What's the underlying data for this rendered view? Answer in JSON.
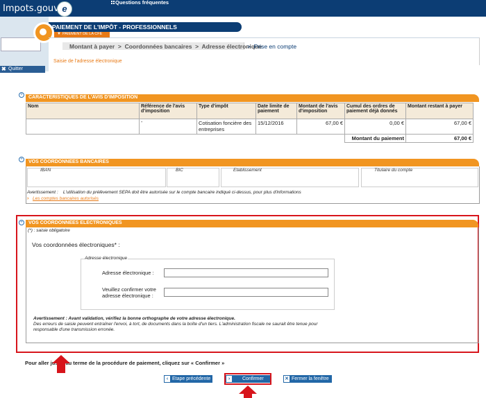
{
  "header": {
    "logo": "Impots.gouv.fr",
    "logo_mark": "e",
    "faq": "Questions fréquentes",
    "quit": "Quitter"
  },
  "titlebar": {
    "title": "PAIEMENT DE L'IMPÔT - PROFESSIONNELS",
    "subtitle_tab": "PAIEMENT DE LA CFE"
  },
  "breadcrumb": {
    "steps": "Montant à payer  >  Coordonnées bancaires  >  Adresse électronique",
    "current": ">  Prise en compte"
  },
  "page_subtitle": "Saisie de l'adresse électronique",
  "avis": {
    "title": "CARACTERISTIQUES DE L'AVIS D'IMPOSITION",
    "headers": [
      "Nom",
      "Référence de l'avis d'imposition",
      "Type d'impôt",
      "Date limite de paiement",
      "Montant de l'avis d'imposition",
      "Cumul des ordres de paiement déjà donnés",
      "Montant restant à payer"
    ],
    "row": [
      "",
      "-",
      "Cotisation foncière des entreprises",
      "15/12/2016",
      "67,00 €",
      "0,00 €",
      "67,00 €"
    ],
    "total_label": "Montant du paiement",
    "total_value": "67,00 €"
  },
  "bank": {
    "title": "VOS COORDONNEES BANCAIRES",
    "iban": "IBAN",
    "bic": "BIC",
    "etablissement": "Etablissement",
    "titulaire": "Titulaire du compte",
    "warning": "Avertissement :    L'utilisation du prélèvement SEPA doit être autorisée sur le compte bancaire indiqué ci-dessus, pour plus d'informations",
    "link": "Les comptes bancaires autorisés"
  },
  "electronic": {
    "title": "VOS COORDONNEES ELECTRONIQUES",
    "mandatory": "(*) : saisie obligatoire",
    "label": "Vos coordonnées électroniques* :",
    "fieldset_legend": "Adresse électronique",
    "email_label": "Adresse électronique :",
    "confirm_label_1": "Veuillez confirmer votre",
    "confirm_label_2": "adresse électronique :",
    "email_value": "",
    "confirm_value": "",
    "warn_1": "Avertissement : Avant validation, vérifiez la bonne orthographe de votre adresse électronique.",
    "warn_2": "Des erreurs de saisie peuvent entraîner l'envoi, à tort, de documents dans la boîte d'un tiers. L'administration fiscale ne saurait être tenue pour",
    "warn_3": "responsable d'une transmission erronée."
  },
  "footer": {
    "instruction": "Pour aller jusqu'au terme de la procédure de paiement, cliquez sur « Confirmer »",
    "btn_prev": "Etape précédente",
    "btn_confirm": "Confirmer",
    "btn_close": "Fermer la fenêtre"
  },
  "colors": {
    "navy": "#0c3d74",
    "orange": "#f19521",
    "highlight": "#d7141b",
    "button": "#2267a7"
  }
}
